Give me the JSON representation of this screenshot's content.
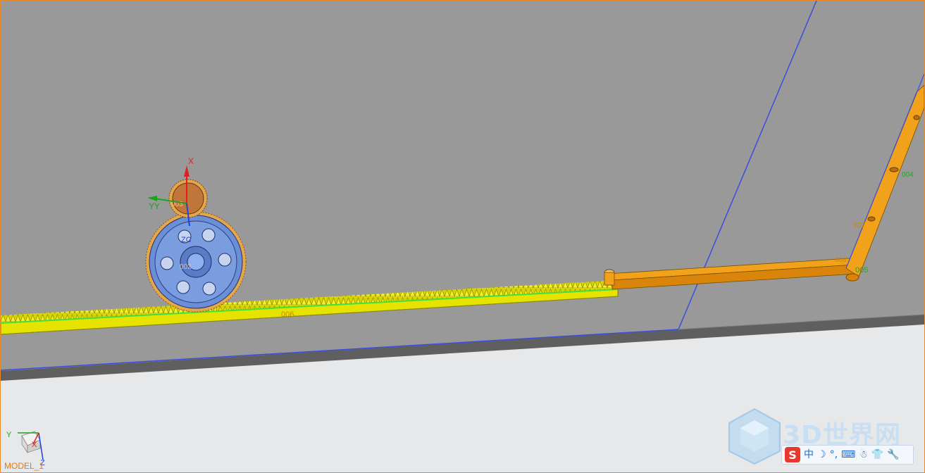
{
  "viewport": {
    "model_label": "MODEL_1",
    "triad": {
      "y": "Y",
      "x": "X",
      "z": "Z"
    }
  },
  "scene": {
    "gear_csys": {
      "x": "X",
      "y": "YY",
      "zc": "ZC"
    },
    "part_labels": {
      "pinion": "003",
      "big_gear": "002",
      "rack": "006",
      "arm_a": "004",
      "joint_b": "005",
      "joint_c": "007",
      "joint_d": "008"
    }
  },
  "watermark": {
    "text": "3D世界网"
  },
  "ime_toolbar": {
    "logo": "S",
    "items": [
      "中",
      "☽",
      "°,",
      "⌨",
      "☃",
      "👕",
      "🔧"
    ]
  },
  "colors": {
    "background_plane": "#999999",
    "rack": "#e6e300",
    "rack_highlight": "#3fe03f",
    "big_gear": "#6b8fd6",
    "pinion": "#c0763a",
    "link_arm": "#f2a21a",
    "edge_line": "#3a4ee0",
    "viewport_border": "#e88a2a"
  }
}
